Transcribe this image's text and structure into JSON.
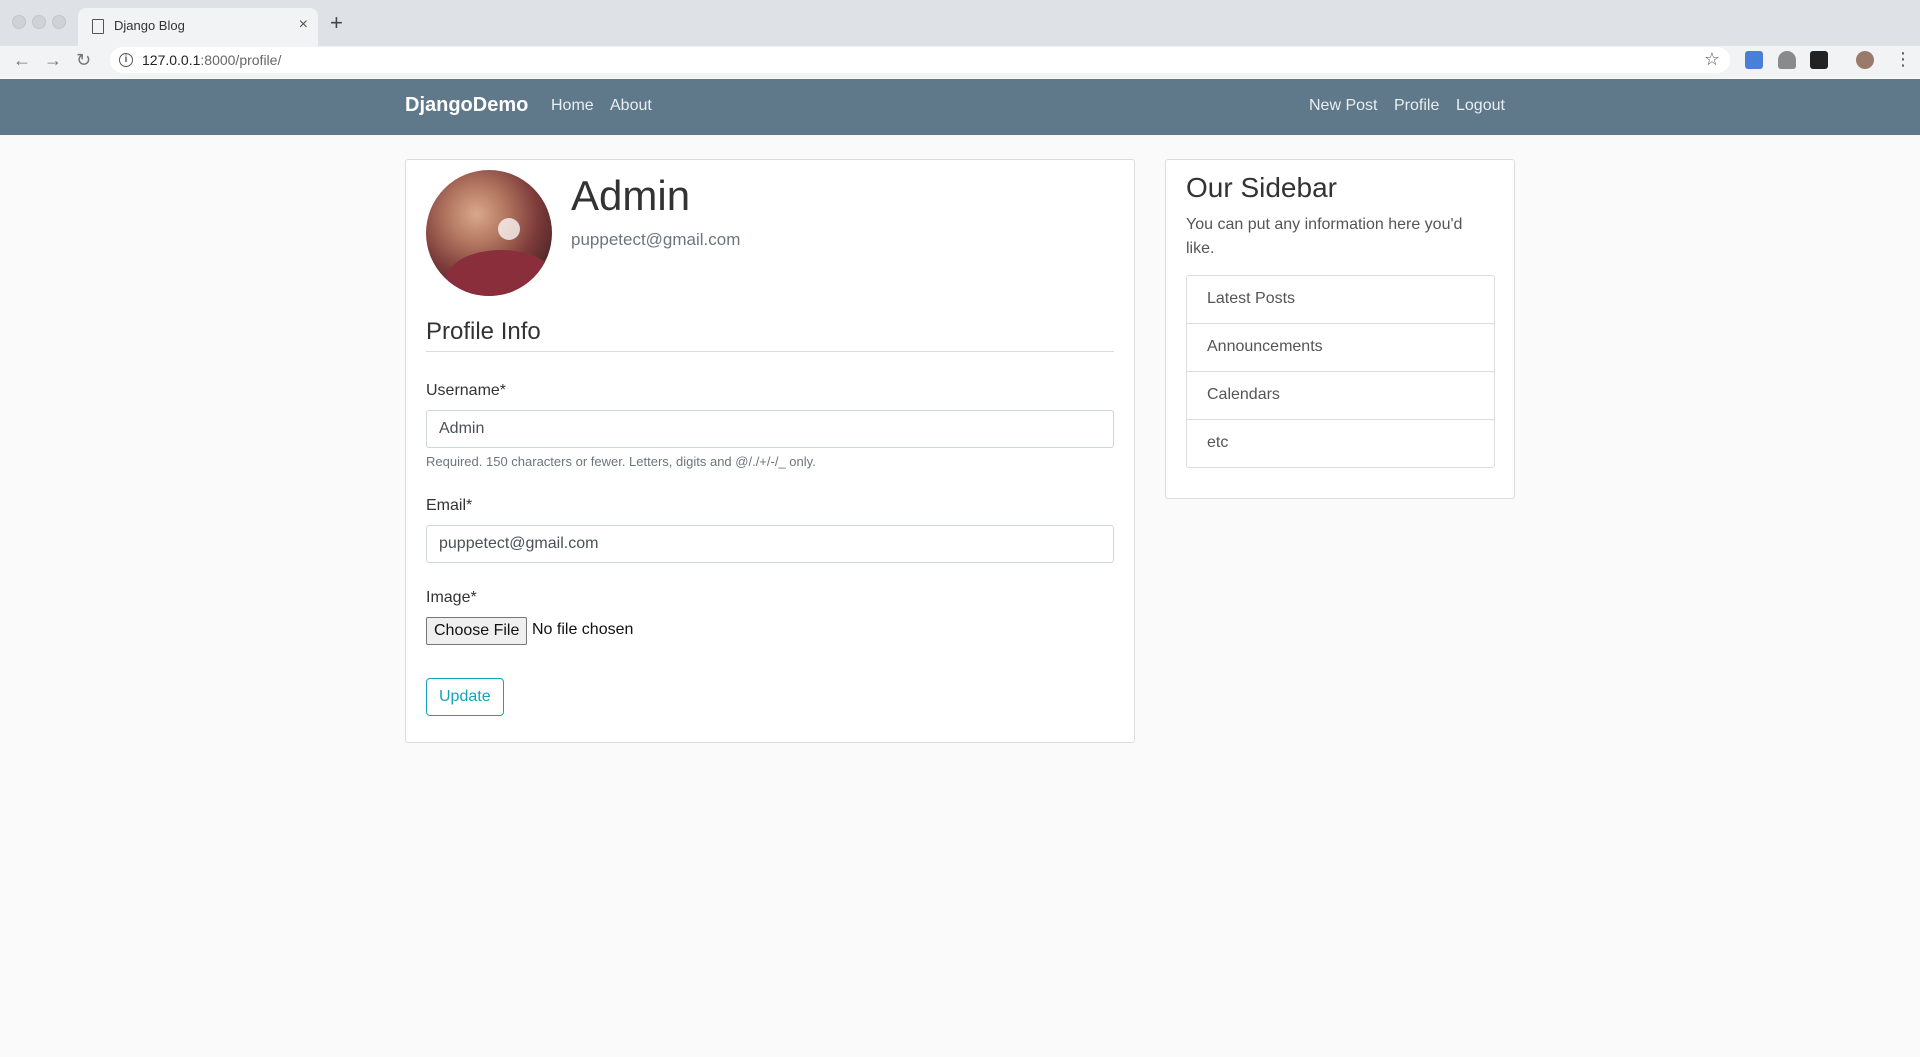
{
  "browser": {
    "tab_title": "Django Blog",
    "tab_close": "×",
    "new_tab": "+",
    "url_host": "127.0.0.1",
    "url_rest": ":8000/profile/",
    "back": "←",
    "forward": "→",
    "reload": "↻",
    "star": "☆",
    "menu": "⋮"
  },
  "navbar": {
    "brand": "DjangoDemo",
    "left_links": [
      "Home",
      "About"
    ],
    "right_links": [
      "New Post",
      "Profile",
      "Logout"
    ],
    "color": "#5f788a"
  },
  "profile": {
    "name": "Admin",
    "email": "puppetect@gmail.com"
  },
  "form": {
    "legend": "Profile Info",
    "username_label": "Username*",
    "username_value": "Admin",
    "username_help": "Required. 150 characters or fewer. Letters, digits and @/./+/-/_ only.",
    "email_label": "Email*",
    "email_value": "puppetect@gmail.com",
    "image_label": "Image*",
    "file_button": "Choose File",
    "file_status": "No file chosen",
    "submit_label": "Update",
    "accent": "#17a2b8"
  },
  "sidebar": {
    "title": "Our Sidebar",
    "text": "You can put any information here you'd like.",
    "items": [
      "Latest Posts",
      "Announcements",
      "Calendars",
      "etc"
    ]
  }
}
